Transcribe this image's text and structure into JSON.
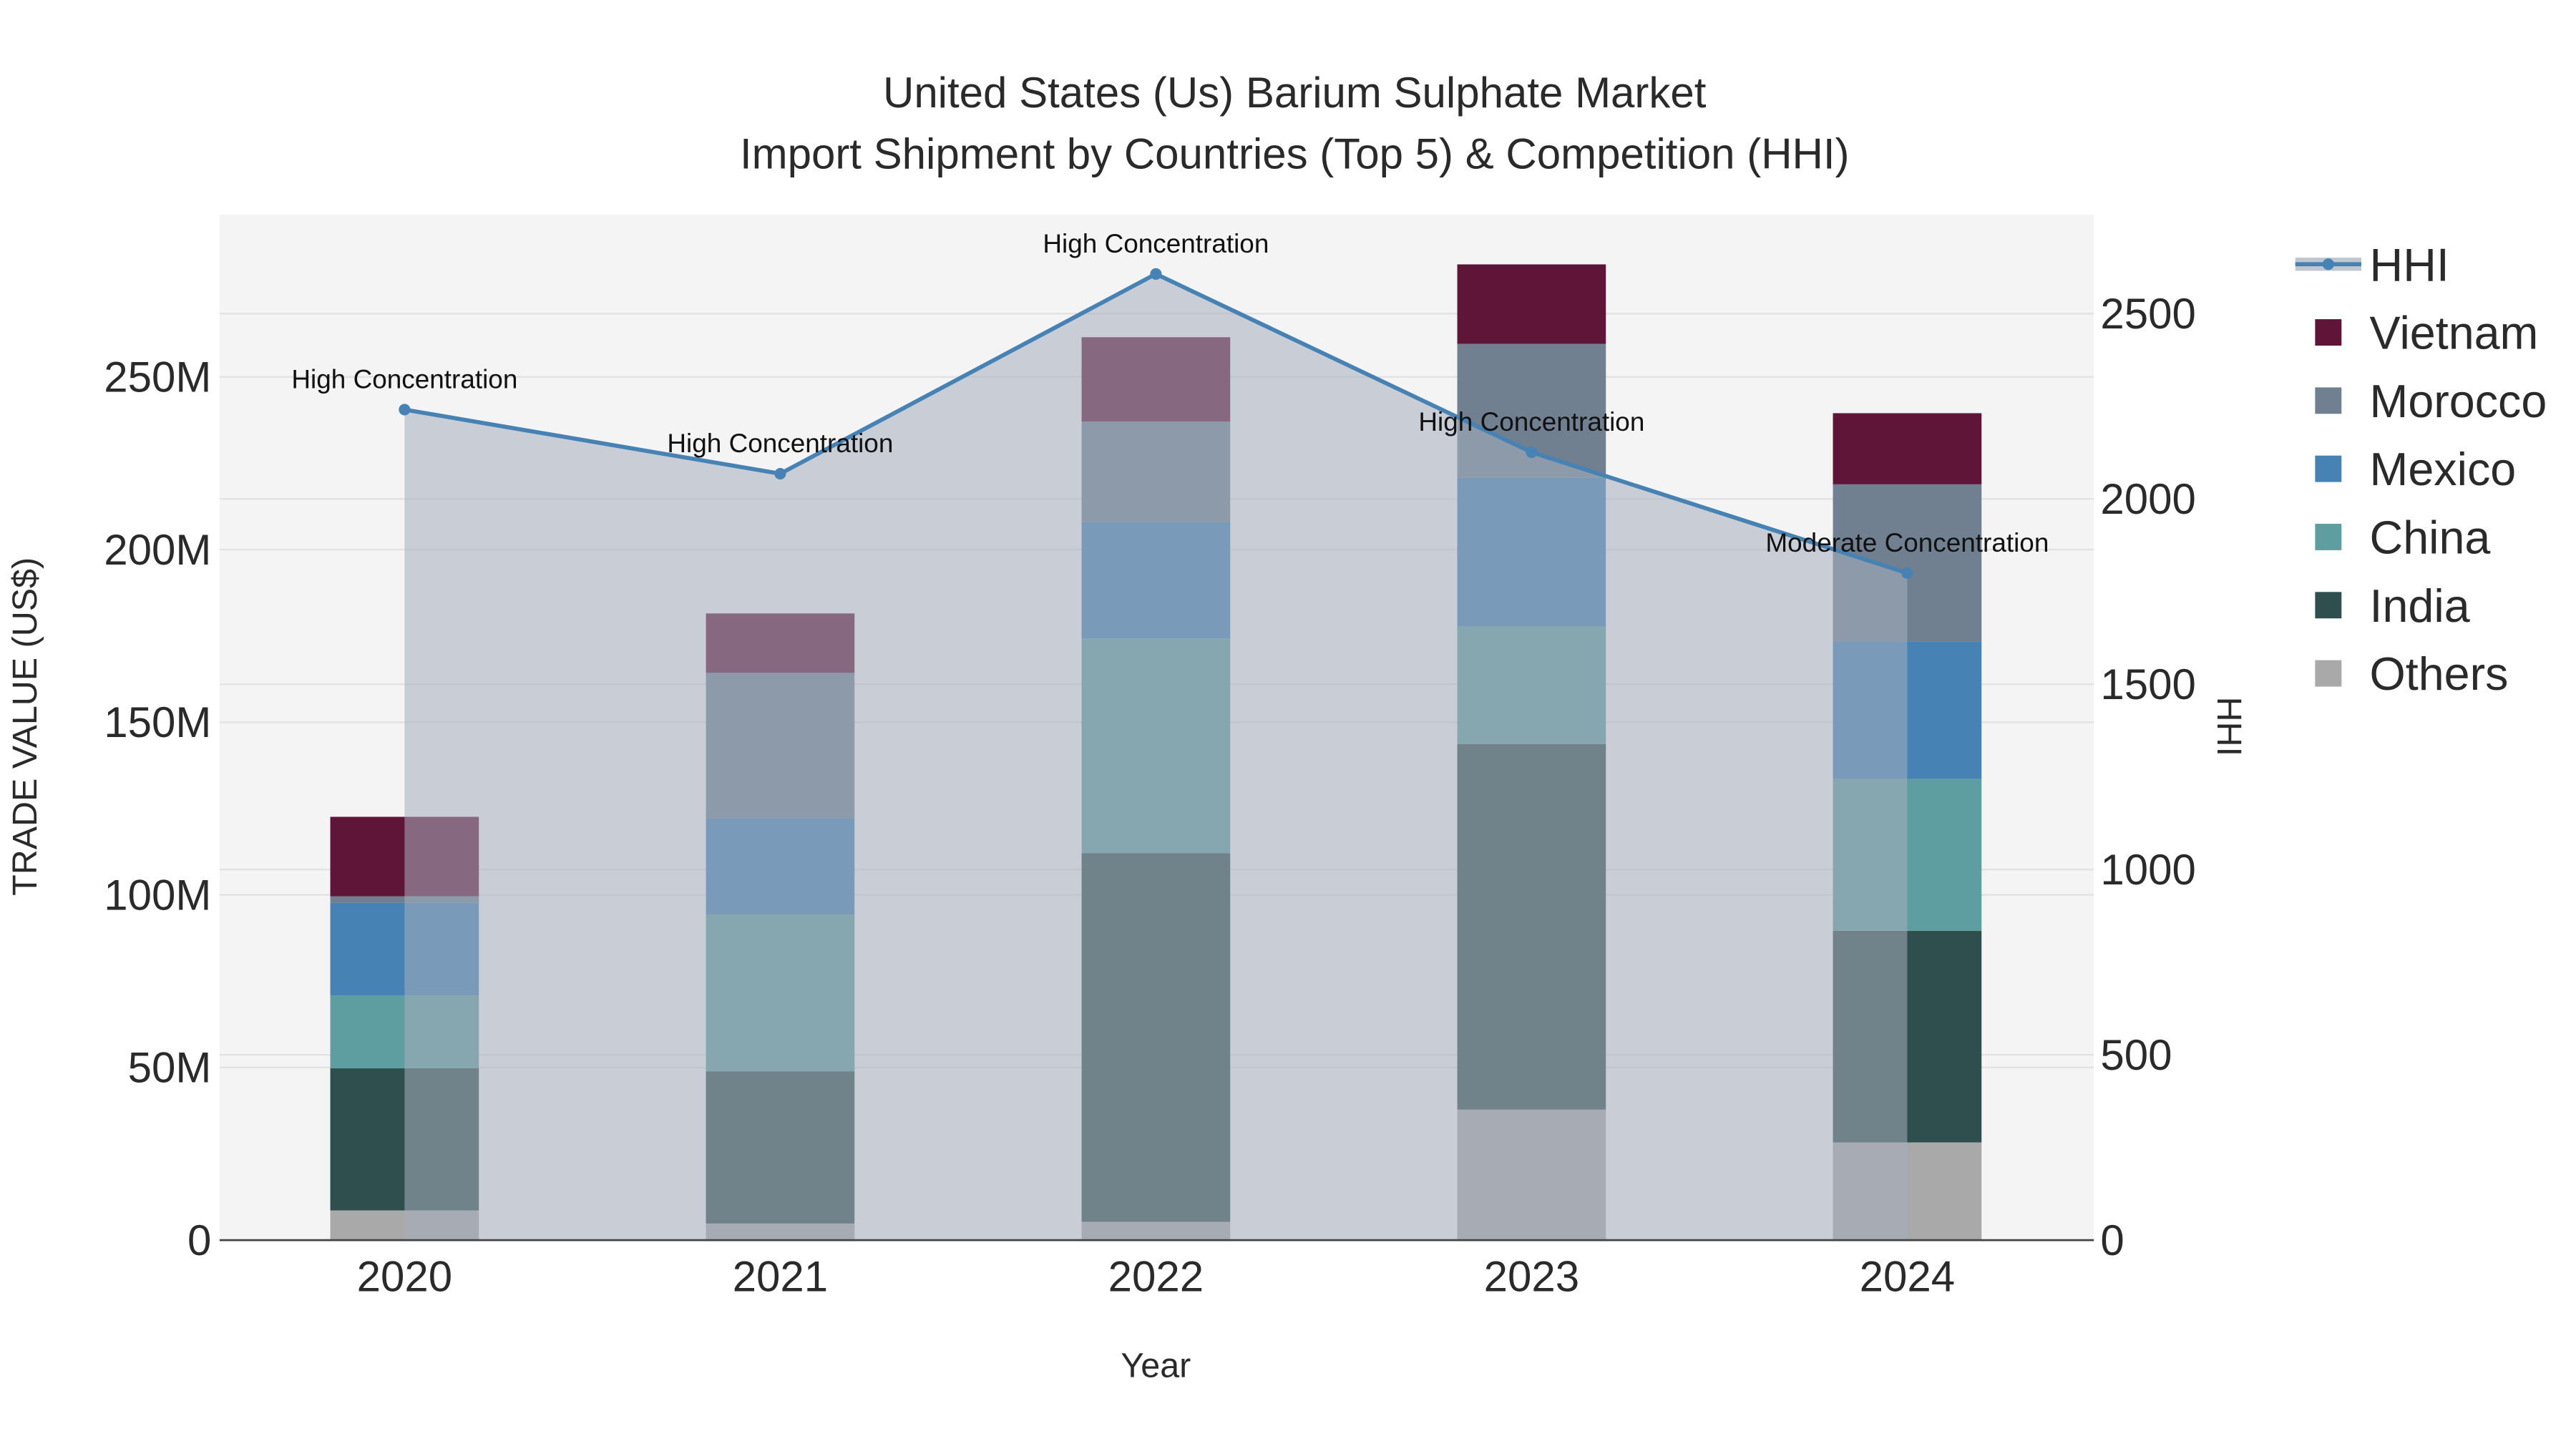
{
  "chart_data": {
    "type": "bar",
    "stacked": true,
    "title_line1": "United States (Us) Barium Sulphate Market",
    "title_line2": "Import Shipment by Countries (Top 5) & Competition (HHI)",
    "xlabel": "Year",
    "ylabel": "TRADE VALUE (US$)",
    "y2label": "HHI",
    "categories": [
      "2020",
      "2021",
      "2022",
      "2023",
      "2024"
    ],
    "ylim": [
      0,
      297
    ],
    "y2lim": [
      0,
      2767
    ],
    "yticks": [
      {
        "v": 0,
        "label": "0"
      },
      {
        "v": 50,
        "label": "50M"
      },
      {
        "v": 100,
        "label": "100M"
      },
      {
        "v": 150,
        "label": "150M"
      },
      {
        "v": 200,
        "label": "200M"
      },
      {
        "v": 250,
        "label": "250M"
      }
    ],
    "y2ticks": [
      {
        "v": 0,
        "label": "0"
      },
      {
        "v": 500,
        "label": "500"
      },
      {
        "v": 1000,
        "label": "1000"
      },
      {
        "v": 1500,
        "label": "1500"
      },
      {
        "v": 2000,
        "label": "2000"
      },
      {
        "v": 2500,
        "label": "2500"
      }
    ],
    "units": "million US$",
    "series": [
      {
        "name": "Others",
        "color": "#a9a9a9",
        "values": [
          8.6,
          4.8,
          5.3,
          37.8,
          28.3
        ]
      },
      {
        "name": "India",
        "color": "#2f4f4f",
        "values": [
          41.2,
          44.1,
          106.8,
          105.9,
          61.3
        ]
      },
      {
        "name": "China",
        "color": "#5f9ea0",
        "values": [
          21.1,
          45.4,
          62.2,
          34.0,
          44.0
        ]
      },
      {
        "name": "Mexico",
        "color": "#4682b4",
        "values": [
          26.8,
          27.8,
          33.6,
          43.1,
          39.8
        ]
      },
      {
        "name": "Morocco",
        "color": "#708090",
        "values": [
          1.9,
          42.2,
          29.2,
          38.8,
          45.5
        ]
      },
      {
        "name": "Vietnam",
        "color": "#5f1537",
        "values": [
          23.0,
          17.2,
          24.4,
          23.0,
          20.6
        ]
      }
    ],
    "hhi": {
      "name": "HHI",
      "color": "#4682b4",
      "values": [
        2241,
        2068,
        2607,
        2126,
        1800
      ],
      "annotations": [
        "High Concentration",
        "High Concentration",
        "High Concentration",
        "High Concentration",
        "Moderate Concentration"
      ]
    },
    "legend": [
      "HHI",
      "Vietnam",
      "Morocco",
      "Mexico",
      "China",
      "India",
      "Others"
    ],
    "legend_position": "right",
    "grid": true
  }
}
